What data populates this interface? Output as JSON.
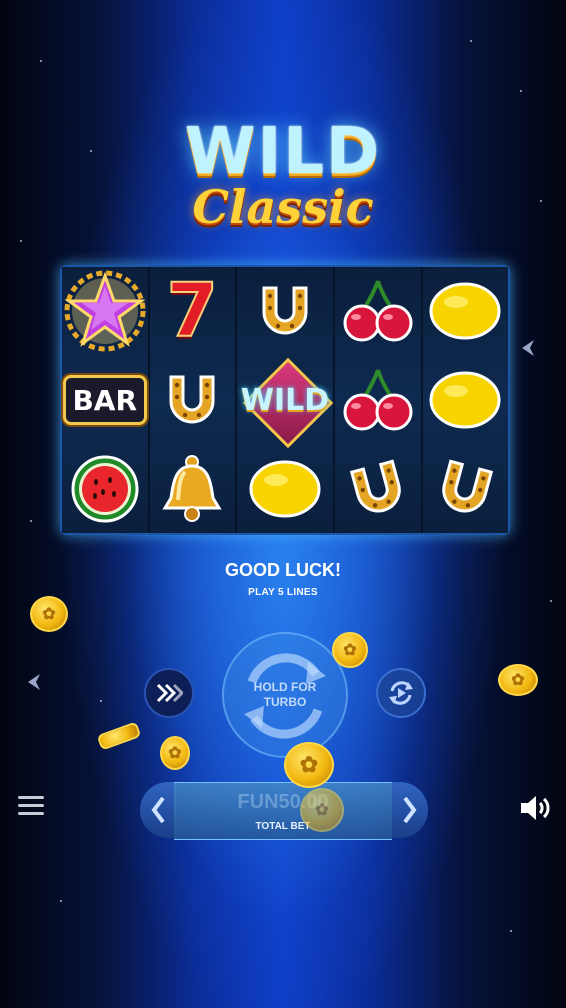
{
  "game": {
    "logo_line1": "WILD",
    "logo_line2": "Classic"
  },
  "reels": [
    [
      "star-icon",
      "bar-icon",
      "watermelon-icon"
    ],
    [
      "seven-icon",
      "horseshoe-icon",
      "bell-icon"
    ],
    [
      "horseshoe-icon",
      "wild-icon",
      "lemon-icon"
    ],
    [
      "cherries-icon",
      "cherries-icon",
      "horseshoe-icon"
    ],
    [
      "lemon-icon",
      "lemon-icon",
      "horseshoe-icon"
    ]
  ],
  "symbols": {
    "bar_label": "BAR",
    "seven_label": "7",
    "wild_label": "WILD"
  },
  "status": {
    "message": "GOOD LUCK!",
    "sub_message": "PLAY 5 LINES"
  },
  "controls": {
    "spin_label_line1": "HOLD FOR",
    "spin_label_line2": "TURBO",
    "bet_value": "FUN50.00",
    "bet_label": "TOTAL BET",
    "turbo_icon": "fast-forward-icon",
    "autoplay_icon": "autoplay-icon",
    "menu_icon": "hamburger-menu-icon",
    "sound_icon": "speaker-icon"
  },
  "colors": {
    "background_center": "#0f3fc8",
    "logo_gold": "#ffd23a",
    "logo_cyan": "#bff3ff",
    "coin_gold": "#f2b810"
  }
}
